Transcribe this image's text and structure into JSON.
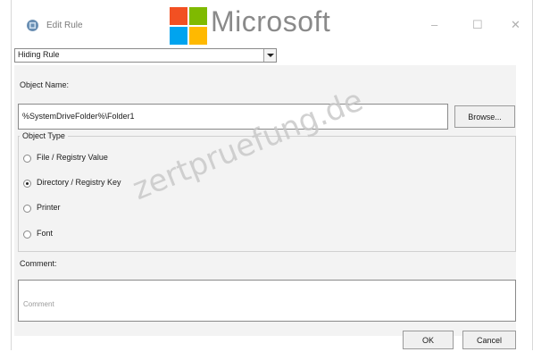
{
  "window": {
    "title": "Edit Rule",
    "minimize_glyph": "–",
    "maximize_glyph": "☐",
    "close_glyph": "✕"
  },
  "overlay": {
    "brand_text": "Microsoft",
    "logo_colors": [
      "#f25022",
      "#7fba00",
      "#00a4ef",
      "#ffb900"
    ],
    "watermark": "zertpruefung.de"
  },
  "rule_type": {
    "selected": "Hiding Rule"
  },
  "object_name": {
    "label": "Object Name:",
    "value": "%SystemDriveFolder%\\Folder1",
    "browse_label": "Browse..."
  },
  "object_type": {
    "title": "Object Type",
    "options": [
      {
        "label": "File / Registry Value",
        "selected": false
      },
      {
        "label": "Directory / Registry Key",
        "selected": true
      },
      {
        "label": "Printer",
        "selected": false
      },
      {
        "label": "Font",
        "selected": false
      }
    ]
  },
  "comment": {
    "label": "Comment:",
    "placeholder": "Comment"
  },
  "footer": {
    "ok_label": "OK",
    "cancel_label": "Cancel"
  }
}
